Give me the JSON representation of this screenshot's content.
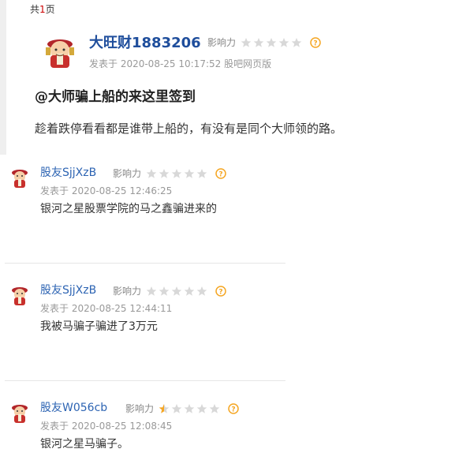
{
  "page_info": {
    "prefix": "共",
    "num": "1",
    "suffix": "页"
  },
  "main_post": {
    "author": "大旺财1883206",
    "influence_label": "影响力",
    "influence_stars": 0,
    "meta": "发表于 2020-08-25 10:17:52 股吧网页版",
    "title": "@大师骗上船的来这里签到",
    "content": "趁着跌停看看都是谁带上船的，有没有是同个大师领的路。"
  },
  "replies": [
    {
      "author": "股友SjjXzB",
      "influence_label": "影响力",
      "influence_stars": 0,
      "meta": "发表于 2020-08-25 12:46:25",
      "content": "银河之星股票学院的马之鑫骗进来的"
    },
    {
      "author": "股友SjjXzB",
      "influence_label": "影响力",
      "influence_stars": 0,
      "meta": "发表于 2020-08-25 12:44:11",
      "content": "我被马骗子骗进了3万元"
    },
    {
      "author": "股友W056cb",
      "influence_label": "影响力",
      "influence_stars": 0.5,
      "meta": "发表于 2020-08-25 12:08:45",
      "content": "银河之星马骗子。"
    }
  ],
  "colors": {
    "star_empty": "#d8d8d8",
    "star_filled": "#f5a623",
    "help": "#f5a623",
    "author": "#1f4e9c"
  }
}
